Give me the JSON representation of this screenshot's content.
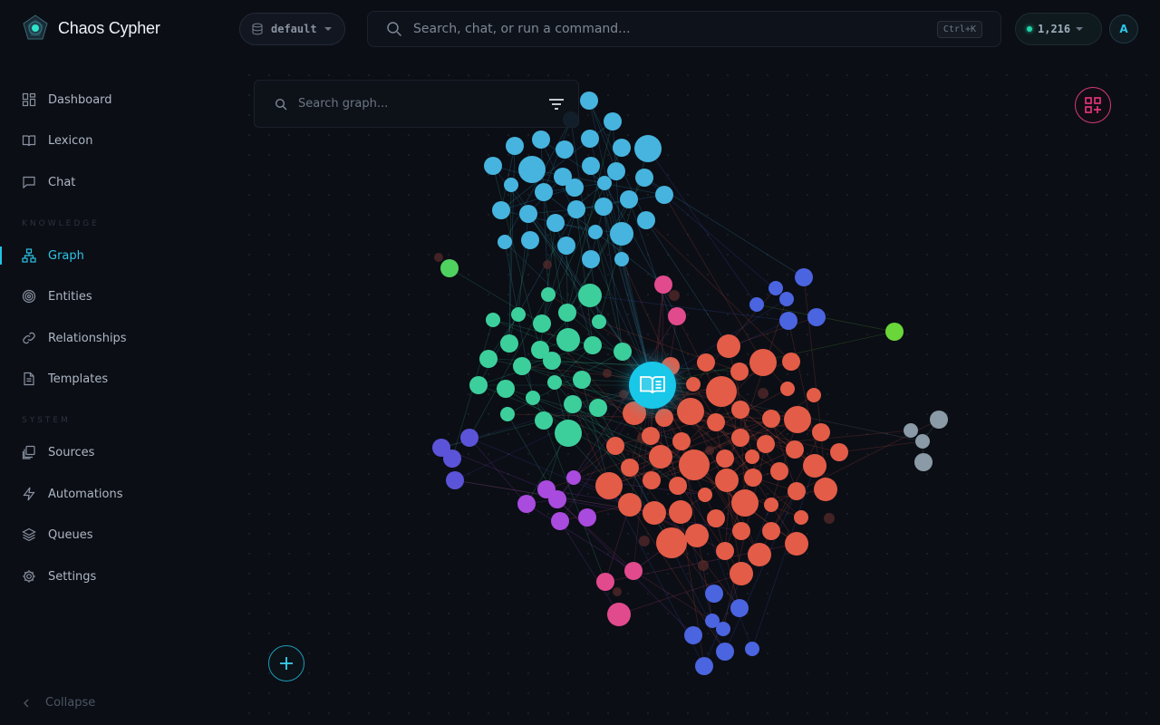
{
  "brand": {
    "name": "Chaos Cypher",
    "logo_icon": "chaos-cypher-logo"
  },
  "workspace": {
    "value": "default"
  },
  "command_bar": {
    "placeholder": "Search, chat, or run a command...",
    "shortcut": "Ctrl+K"
  },
  "credits": {
    "value": "1,216"
  },
  "user": {
    "initial": "A"
  },
  "sidebar": {
    "primary": [
      {
        "label": "Dashboard",
        "icon": "dashboard-icon"
      },
      {
        "label": "Lexicon",
        "icon": "book-icon"
      },
      {
        "label": "Chat",
        "icon": "chat-icon"
      }
    ],
    "knowledge_label": "KNOWLEDGE",
    "knowledge": [
      {
        "label": "Graph",
        "icon": "graph-icon",
        "active": true
      },
      {
        "label": "Entities",
        "icon": "target-icon"
      },
      {
        "label": "Relationships",
        "icon": "link-icon"
      },
      {
        "label": "Templates",
        "icon": "document-icon"
      }
    ],
    "system_label": "SYSTEM",
    "system": [
      {
        "label": "Sources",
        "icon": "sources-icon"
      },
      {
        "label": "Automations",
        "icon": "lightning-icon"
      },
      {
        "label": "Queues",
        "icon": "layers-icon"
      },
      {
        "label": "Settings",
        "icon": "gear-icon"
      }
    ],
    "collapse_label": "Collapse"
  },
  "graph": {
    "search_placeholder": "Search graph...",
    "colors": {
      "blue_cluster": "#46b4de",
      "teal_cluster": "#3ccf9c",
      "red_cluster": "#e35c47",
      "purple_cluster": "#a94bde",
      "indigo_cluster": "#5b54d8",
      "royal_cluster": "#4b64e0",
      "pink": "#e24a8e",
      "green": "#4fd15f",
      "lime": "#6ad63a",
      "gray": "#8a9aa6",
      "center": "#19c7e8"
    }
  }
}
